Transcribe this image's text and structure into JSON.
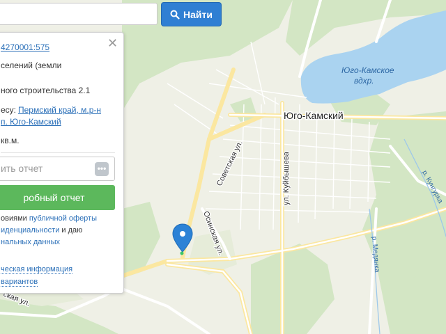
{
  "search": {
    "button_label": "Найти",
    "placeholder": ""
  },
  "panel": {
    "cadastral_link": "4270001:575",
    "category_line": "селений (земли",
    "use_line": "ного строительства 2.1",
    "address_prefix": "есу:",
    "address_link_1": "Пермский край, м.р-н",
    "address_link_2": "п. Юго-Камский",
    "area": "кв.м.",
    "email_placeholder": "ить отчет",
    "order_button": "робный отчет",
    "consent_1_prefix": "овиями ",
    "consent_1_link": "публичной оферты",
    "consent_2_link": "иденциальности",
    "consent_2_suffix": " и даю",
    "consent_3_link": "нальных данных",
    "tech_info": "ческая информация",
    "variants": " вариантов"
  },
  "map": {
    "settlement": "Юго-Камский",
    "reservoir_line_1": "Юго-Камское",
    "reservoir_line_2": "вдхр.",
    "street_sovetskaya": "Советская ул.",
    "street_kuybysheva": "ул. Куйбышева",
    "street_osinskaya": "Осинская ул.",
    "river_medyanka": "р. Медянка",
    "river_kungurka": "р. Кунгурка",
    "street_sw": "ская ул."
  },
  "colors": {
    "water": "#aad3f0",
    "forest": "#cfe5bd",
    "road": "#fff2b3",
    "marker": "#2c82d6",
    "button": "#2f7fd3",
    "order": "#5cb85c"
  },
  "icons": {
    "search": "magnifier-icon",
    "close": "close-icon",
    "marker": "map-pin-icon",
    "more": "dots-icon"
  }
}
